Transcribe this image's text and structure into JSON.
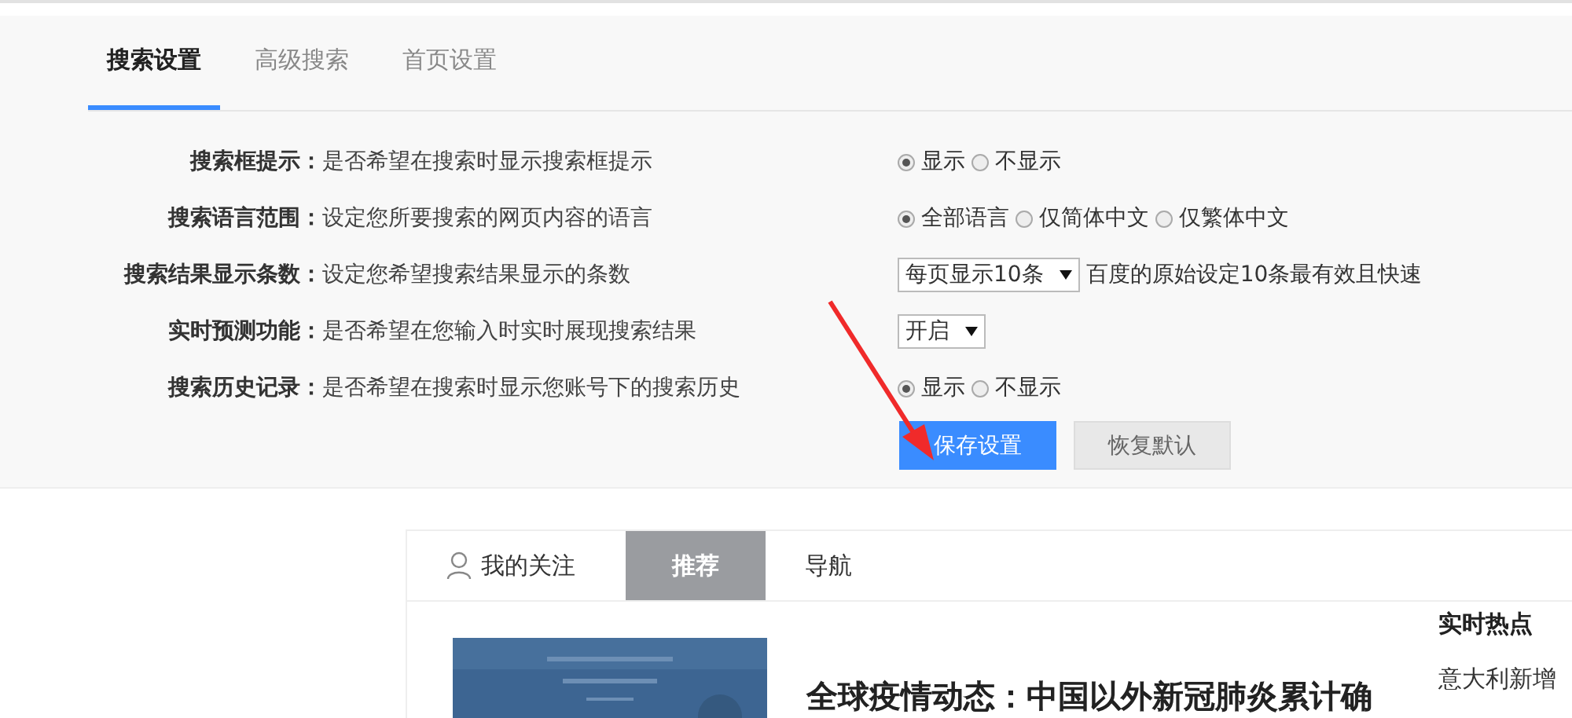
{
  "settings_tabs": [
    {
      "label": "搜索设置",
      "selected": true
    },
    {
      "label": "高级搜索",
      "selected": false
    },
    {
      "label": "首页设置",
      "selected": false
    }
  ],
  "settings": [
    {
      "label": "搜索框提示：",
      "description": "是否希望在搜索时显示搜索框提示",
      "kind": "radio",
      "options": [
        {
          "label": "显示",
          "selected": true
        },
        {
          "label": "不显示",
          "selected": false
        }
      ]
    },
    {
      "label": "搜索语言范围：",
      "description": "设定您所要搜索的网页内容的语言",
      "kind": "radio",
      "options": [
        {
          "label": "全部语言",
          "selected": true
        },
        {
          "label": "仅简体中文",
          "selected": false
        },
        {
          "label": "仅繁体中文",
          "selected": false
        }
      ]
    },
    {
      "label": "搜索结果显示条数：",
      "description": "设定您希望搜索结果显示的条数",
      "kind": "select",
      "value": "每页显示10条",
      "note": "百度的原始设定10条最有效且快速"
    },
    {
      "label": "实时预测功能：",
      "description": "是否希望在您输入时实时展现搜索结果",
      "kind": "select",
      "value": "开启"
    },
    {
      "label": "搜索历史记录：",
      "description": "是否希望在搜索时显示您账号下的搜索历史",
      "kind": "radio",
      "options": [
        {
          "label": "显示",
          "selected": true
        },
        {
          "label": "不显示",
          "selected": false
        }
      ]
    }
  ],
  "buttons": [
    {
      "label": "保存设置",
      "kind": "primary"
    },
    {
      "label": "恢复默认",
      "kind": "secondary"
    }
  ],
  "feed_tabs": [
    {
      "label": "我的关注",
      "selected": false,
      "icon": true
    },
    {
      "label": "推荐",
      "selected": true,
      "icon": false
    },
    {
      "label": "导航",
      "selected": false,
      "icon": false
    }
  ],
  "feed": {
    "headline": "全球疫情动态：中国以外新冠肺炎累计确",
    "hot_title": "实时热点",
    "hot_item": "意大利新增"
  }
}
